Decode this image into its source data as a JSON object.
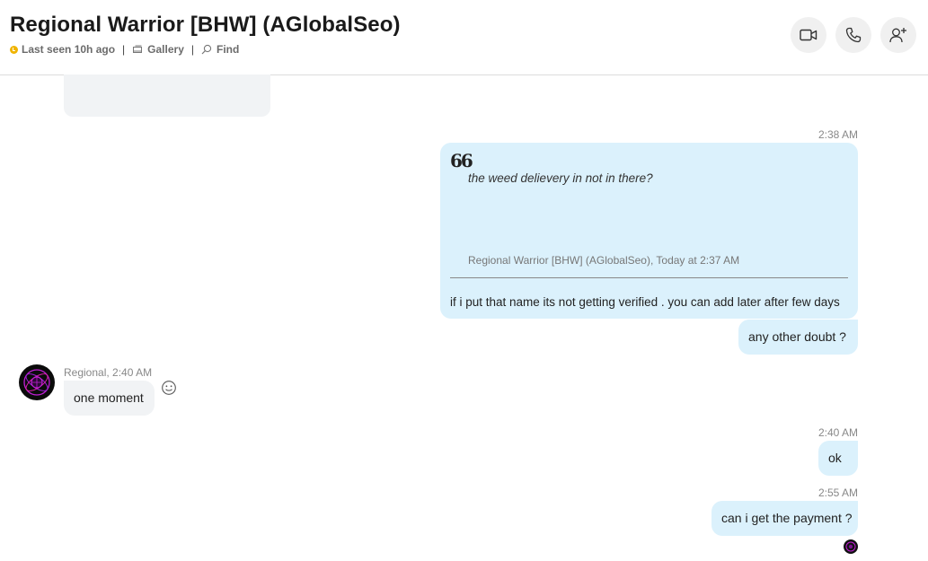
{
  "header": {
    "title": "Regional Warrior [BHW] (AGlobalSeo)",
    "status": "Last seen 10h ago",
    "gallery": "Gallery",
    "find": "Find",
    "separator": "|"
  },
  "actions": {
    "video_call": "video-camera-icon",
    "audio_call": "phone-icon",
    "add_people": "add-person-icon"
  },
  "messages": {
    "ts_1": "2:38 AM",
    "quote": {
      "mark": "66",
      "text": "the weed delievery in not in there?",
      "meta": "Regional Warrior [BHW] (AGlobalSeo), Today at 2:37 AM",
      "reply": "if i put that name its not getting verified . you can add later after few days"
    },
    "out_1": "any other doubt ?",
    "in_meta": "Regional, 2:40 AM",
    "in_1": "one moment",
    "ts_2": "2:40 AM",
    "out_2": "ok",
    "ts_3": "2:55 AM",
    "out_3": "can i get the payment ?"
  },
  "colors": {
    "outgoing_bubble": "#dbf1fc",
    "incoming_bubble": "#f1f3f5",
    "status_away": "#f0b400",
    "avatar_accent": "#c21fd6"
  }
}
